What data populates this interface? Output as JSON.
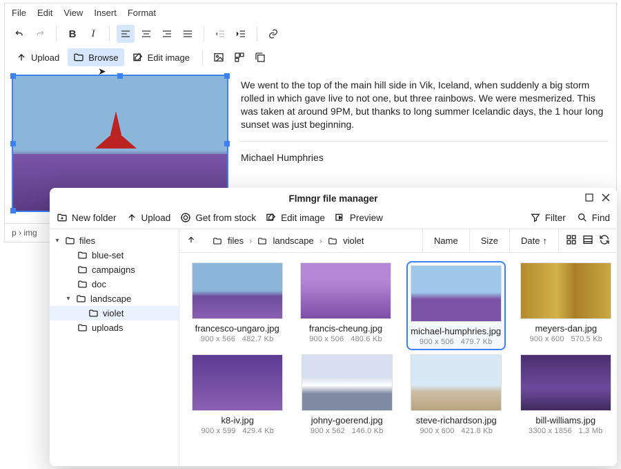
{
  "menu": {
    "file": "File",
    "edit": "Edit",
    "view": "View",
    "insert": "Insert",
    "format": "Format"
  },
  "toolbar2": {
    "upload": "Upload",
    "browse": "Browse",
    "editimg": "Edit image"
  },
  "article": {
    "text": "We went to the top of the main hill side in Vik, Iceland, when suddenly a big storm rolled in which gave live to not one, but three rainbows. We were mesmerized. This was taken at around 9PM, but thanks to long summer Icelandic days, the 1 hour long sunset was just beginning.",
    "author": "Michael Humphries"
  },
  "statusbar": "p › img",
  "dialog": {
    "title": "Flmngr file manager",
    "actions": {
      "newfolder": "New folder",
      "upload": "Upload",
      "stock": "Get from stock",
      "editimg": "Edit image",
      "preview": "Preview",
      "filter": "Filter",
      "find": "Find"
    },
    "breadcrumb": [
      "files",
      "landscape",
      "violet"
    ],
    "sort": {
      "name": "Name",
      "size": "Size",
      "date": "Date"
    },
    "tree": {
      "root": "files",
      "children": [
        "blue-set",
        "campaigns",
        "doc"
      ],
      "landscape": "landscape",
      "violet": "violet",
      "uploads": "uploads"
    },
    "files": [
      {
        "name": "francesco-ungaro.jpg",
        "dims": "900 x 566",
        "size": "482.7 Kb"
      },
      {
        "name": "francis-cheung.jpg",
        "dims": "900 x 506",
        "size": "480.6 Kb"
      },
      {
        "name": "michael-humphries.jpg",
        "dims": "900 x 506",
        "size": "479.7 Kb"
      },
      {
        "name": "meyers-dan.jpg",
        "dims": "900 x 600",
        "size": "570.5 Kb"
      },
      {
        "name": "k8-iv.jpg",
        "dims": "900 x 599",
        "size": "429.4 Kb"
      },
      {
        "name": "johny-goerend.jpg",
        "dims": "900 x 562",
        "size": "146.0 Kb"
      },
      {
        "name": "steve-richardson.jpg",
        "dims": "900 x 600",
        "size": "421.8 Kb"
      },
      {
        "name": "bill-williams.jpg",
        "dims": "3300 x 1856",
        "size": "1.3 Mb"
      }
    ]
  }
}
